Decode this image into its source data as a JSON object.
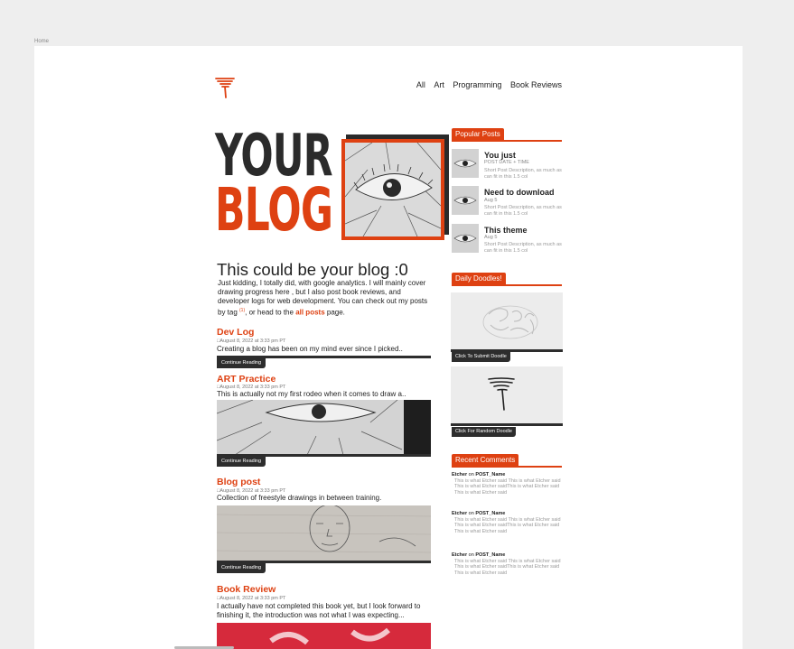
{
  "breadcrumb": "Home",
  "nav": [
    "All",
    "Art",
    "Programming",
    "Book Reviews"
  ],
  "hero": {
    "line1": "YOUR",
    "line2": "BLOG"
  },
  "intro": {
    "heading": "This could be your blog :0",
    "text1": "Just kidding, I totally did, with google analytics. I will mainly cover drawing progress here , but I also post book reviews, and developer logs for web development. You can check out my posts by tag ",
    "tag_marker": "(1)",
    "text2": ", or head to the ",
    "link": "all posts",
    "text3": " page."
  },
  "posts": [
    {
      "title": "Dev Log",
      "date": "August 8, 2022 at 3:33 pm PT",
      "excerpt": "Creating a blog has been on my mind ever since I picked..",
      "button": "Continue Reading"
    },
    {
      "title": "ART Practice",
      "date": "August 8, 2022 at 3:33 pm PT",
      "excerpt": "This is actually not my first rodeo when it comes to draw a..",
      "button": "Continue Reading"
    },
    {
      "title": "Blog post",
      "date": "August 8, 2022 at 3:33 pm PT",
      "excerpt": "Collection of freestyle drawings in between training.",
      "button": "Continue Reading"
    },
    {
      "title": "Book Review",
      "date": "August 8, 2022 at 3:33 pm PT",
      "excerpt": "I actually have not completed this book yet, but I look forward to finishing it, the introduction was not what I was expecting..."
    }
  ],
  "sidebar": {
    "popular": {
      "heading": "Popular Posts",
      "items": [
        {
          "title": "You just",
          "meta": "POST DATE + TIME",
          "desc": "Short Post Description, as much as can fit in this 1.5 col"
        },
        {
          "title": "Need to download",
          "meta": "Aug 5",
          "desc": "Short Post Description, as much as can fit in this 1.5 col"
        },
        {
          "title": "This theme",
          "meta": "Aug 5",
          "desc": "Short Post Description, as much as can fit in this 1.5 col"
        }
      ]
    },
    "doodles": {
      "heading": "Daily Doodles!",
      "submit_button": "Click To Submit Doodle",
      "random_button": "Click For Random Doodle"
    },
    "comments": {
      "heading": "Recent Comments",
      "items": [
        {
          "author": "Etcher",
          "on": " on ",
          "post": "POST_Name",
          "text": "This is what Etcher said This is what Etcher said This is what Etcher saidThis is what Etcher said This is what Etcher said"
        },
        {
          "author": "Etcher",
          "on": " on ",
          "post": "POST_Name",
          "text": "This is what Etcher said This is what Etcher said This is what Etcher saidThis is what Etcher said This is what Etcher said"
        },
        {
          "author": "Etcher",
          "on": " on ",
          "post": "POST_Name",
          "text": "This is what Etcher said This is what Etcher said This is what Etcher saidThis is what Etcher said This is what Etcher said"
        }
      ]
    }
  },
  "colors": {
    "accent": "#de4112",
    "dark": "#2d2d2d",
    "sheet": "#ffffff",
    "page": "#eeeeee"
  }
}
